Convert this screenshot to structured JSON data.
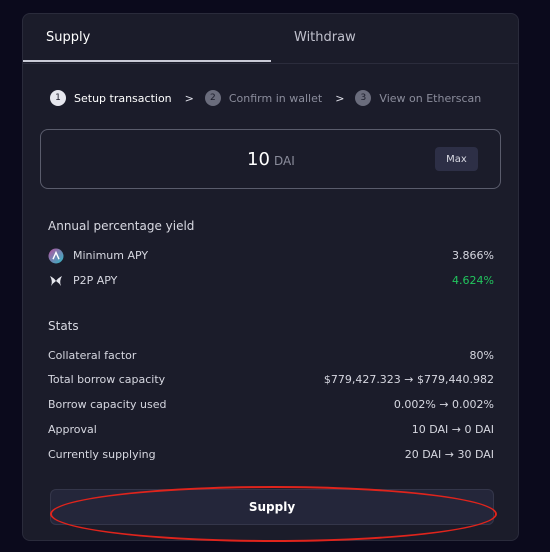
{
  "tabs": [
    {
      "label": "Supply",
      "active": true
    },
    {
      "label": "Withdraw",
      "active": false
    }
  ],
  "steps": [
    {
      "number": "1",
      "label": "Setup transaction",
      "active": true
    },
    {
      "number": "2",
      "label": "Confirm in wallet",
      "active": false
    },
    {
      "number": "3",
      "label": "View on Etherscan",
      "active": false
    }
  ],
  "step_separator": ">",
  "amount": {
    "value": "10",
    "unit": "DAI",
    "max_label": "Max"
  },
  "apy": {
    "title": "Annual percentage yield",
    "rows": [
      {
        "label": "Minimum APY",
        "value": "3.866%",
        "icon": "aave-icon"
      },
      {
        "label": "P2P APY",
        "value": "4.624%",
        "icon": "morpho-butterfly-icon"
      }
    ]
  },
  "stats": {
    "title": "Stats",
    "rows": [
      {
        "label": "Collateral factor",
        "value": "80%"
      },
      {
        "label": "Total borrow capacity",
        "value": "$779,427.323 → $779,440.982"
      },
      {
        "label": "Borrow capacity used",
        "value": "0.002% → 0.002%"
      },
      {
        "label": "Approval",
        "value": "10 DAI → 0 DAI"
      },
      {
        "label": "Currently supplying",
        "value": "20 DAI → 30 DAI"
      }
    ]
  },
  "submit": {
    "label": "Supply"
  },
  "colors": {
    "background": "#0b0a1c",
    "card": "#1b1c2a",
    "green": "#22c55e",
    "highlight": "#e0241c"
  }
}
